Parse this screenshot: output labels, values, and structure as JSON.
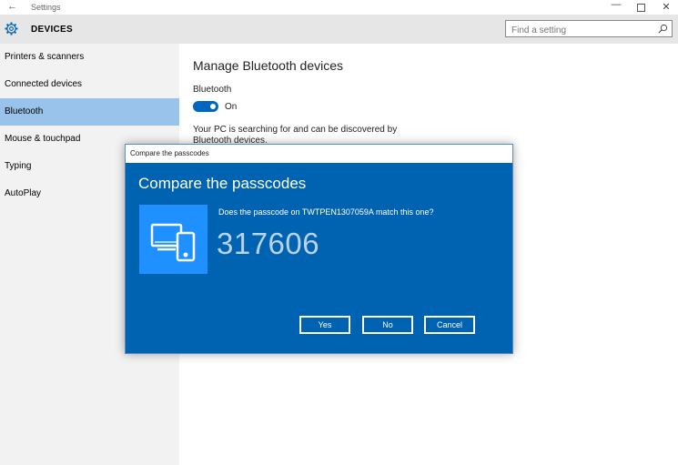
{
  "window": {
    "title": "Settings",
    "back_glyph": "←",
    "minimize_glyph": "—",
    "close_glyph": "✕"
  },
  "header": {
    "heading": "DEVICES",
    "search_placeholder": "Find a setting"
  },
  "sidebar": {
    "items": [
      {
        "label": "Printers & scanners"
      },
      {
        "label": "Connected devices"
      },
      {
        "label": "Bluetooth",
        "active": true
      },
      {
        "label": "Mouse & touchpad"
      },
      {
        "label": "Typing"
      },
      {
        "label": "AutoPlay"
      }
    ]
  },
  "main": {
    "title": "Manage Bluetooth devices",
    "bluetooth_label": "Bluetooth",
    "toggle_state": "On",
    "description": "Your PC is searching for and can be discovered by Bluetooth devices."
  },
  "dialog": {
    "window_title": "Compare the passcodes",
    "heading": "Compare the passcodes",
    "prompt": "Does the passcode on TWTPEN1307059A match this one?",
    "passcode": "317606",
    "buttons": {
      "yes": "Yes",
      "no": "No",
      "cancel": "Cancel"
    }
  },
  "colors": {
    "accent": "#0063b1",
    "tile": "#1e90ff",
    "sidebar_active": "#99c3ea",
    "toggle": "#0067c0"
  }
}
